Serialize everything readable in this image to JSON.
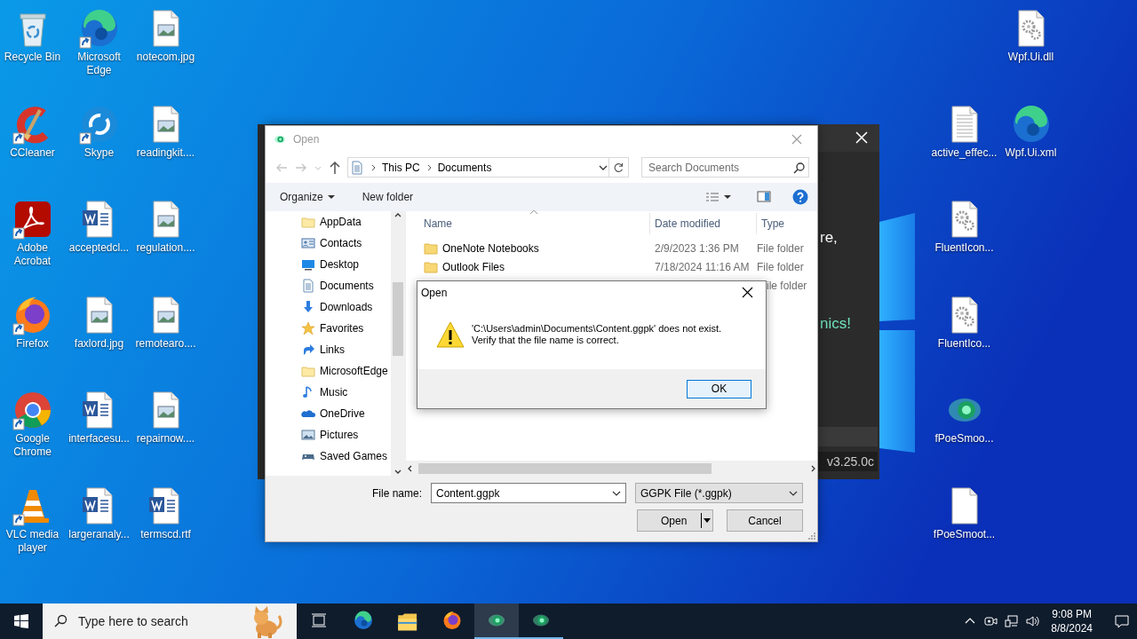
{
  "desktop": {
    "icons": [
      {
        "label": "Recycle Bin",
        "kind": "recycle",
        "shortcut": false
      },
      {
        "label": "CCleaner",
        "kind": "ccleaner",
        "shortcut": true
      },
      {
        "label": "Adobe Acrobat",
        "kind": "acrobat",
        "shortcut": true
      },
      {
        "label": "Firefox",
        "kind": "firefox",
        "shortcut": true
      },
      {
        "label": "Google Chrome",
        "kind": "chrome",
        "shortcut": true
      },
      {
        "label": "VLC media player",
        "kind": "vlc",
        "shortcut": true
      },
      {
        "label": "Microsoft Edge",
        "kind": "edge",
        "shortcut": true
      },
      {
        "label": "Skype",
        "kind": "skype",
        "shortcut": true
      },
      {
        "label": "acceptedcl...",
        "kind": "word",
        "shortcut": false
      },
      {
        "label": "faxlord.jpg",
        "kind": "image",
        "shortcut": false
      },
      {
        "label": "interfacesu...",
        "kind": "word",
        "shortcut": false
      },
      {
        "label": "largeranaly...",
        "kind": "word",
        "shortcut": false
      },
      {
        "label": "notecom.jpg",
        "kind": "image",
        "shortcut": false
      },
      {
        "label": "readingkit....",
        "kind": "image",
        "shortcut": false
      },
      {
        "label": "regulation....",
        "kind": "image",
        "shortcut": false
      },
      {
        "label": "remotearo....",
        "kind": "image",
        "shortcut": false
      },
      {
        "label": "repairnow....",
        "kind": "image",
        "shortcut": false
      },
      {
        "label": "termscd.rtf",
        "kind": "word",
        "shortcut": false
      }
    ],
    "right_icons": [
      {
        "label": "Wpf.Ui.dll",
        "kind": "gear",
        "shortcut": false
      },
      {
        "label": "active_effec...",
        "kind": "text",
        "shortcut": false
      },
      {
        "label": "Wpf.Ui.xml",
        "kind": "edge",
        "shortcut": false
      },
      {
        "label": "FluentIcon...",
        "kind": "gear",
        "shortcut": false
      },
      {
        "label": "FluentIco...",
        "kind": "gear",
        "shortcut": false
      },
      {
        "label": "fPoeSmoo...",
        "kind": "orb",
        "shortcut": false
      },
      {
        "label": "fPoeSmoot...",
        "kind": "blank",
        "shortcut": false
      }
    ]
  },
  "background_app": {
    "snippets": [
      "re,",
      "nics!"
    ],
    "version": "v3.25.0c"
  },
  "open_dialog": {
    "title": "Open",
    "address": [
      "This PC",
      "Documents"
    ],
    "search": {
      "placeholder": "Search Documents"
    },
    "toolbar": [
      "Organize",
      "New folder"
    ],
    "nav_items": [
      {
        "label": "AppData",
        "kind": "folder"
      },
      {
        "label": "Contacts",
        "kind": "contacts"
      },
      {
        "label": "Desktop",
        "kind": "desktop"
      },
      {
        "label": "Documents",
        "kind": "documents"
      },
      {
        "label": "Downloads",
        "kind": "downloads"
      },
      {
        "label": "Favorites",
        "kind": "favorites"
      },
      {
        "label": "Links",
        "kind": "links"
      },
      {
        "label": "MicrosoftEdge",
        "kind": "folder"
      },
      {
        "label": "Music",
        "kind": "music"
      },
      {
        "label": "OneDrive",
        "kind": "onedrive"
      },
      {
        "label": "Pictures",
        "kind": "pictures"
      },
      {
        "label": "Saved Games",
        "kind": "games"
      }
    ],
    "columns": [
      "Name",
      "Date modified",
      "Type"
    ],
    "files": [
      {
        "name": "OneNote Notebooks",
        "date": "2/9/2023 1:36 PM",
        "type": "File folder"
      },
      {
        "name": "Outlook Files",
        "date": "7/18/2024 11:16 AM",
        "type": "File folder"
      },
      {
        "type": "ile folder"
      }
    ],
    "file_name": {
      "label": "File name:",
      "value": "Content.ggpk"
    },
    "file_type": "GGPK File (*.ggpk)",
    "buttons": [
      "Open",
      "Cancel"
    ]
  },
  "error_dialog": {
    "title": "Open",
    "message_lines": [
      "'C:\\Users\\admin\\Documents\\Content.ggpk' does not exist.",
      "Verify that the file name is correct."
    ],
    "button": "OK"
  },
  "taskbar": {
    "search_placeholder": "Type here to search",
    "apps": [
      {
        "kind": "taskview",
        "running": false,
        "selected": false
      },
      {
        "kind": "edge",
        "running": false,
        "selected": false
      },
      {
        "kind": "explorer",
        "running": false,
        "selected": false
      },
      {
        "kind": "firefox",
        "running": false,
        "selected": false
      },
      {
        "kind": "orb",
        "running": true,
        "selected": true
      },
      {
        "kind": "orb",
        "running": true,
        "selected": false
      }
    ],
    "time": "9:08 PM",
    "date": "8/8/2024"
  }
}
